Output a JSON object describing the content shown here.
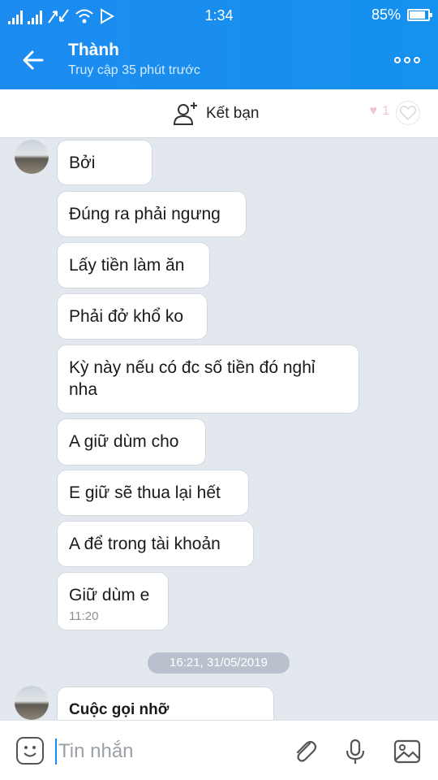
{
  "status_bar": {
    "time": "1:34",
    "battery": "85%",
    "battery_level": 0.85
  },
  "header": {
    "contact_name": "Thành",
    "last_seen": "Truy cập 35 phút trước"
  },
  "friend_bar": {
    "add_friend_label": "Kết bạn",
    "like_count": "1"
  },
  "messages": [
    {
      "text": "Bởi"
    },
    {
      "text": "Đúng ra phải ngưng"
    },
    {
      "text": "Lấy tiền làm ăn"
    },
    {
      "text": "Phải đở khổ ko"
    },
    {
      "text": "Kỳ này nếu có đc số tiền đó nghỉ nha"
    },
    {
      "text": "A giữ dùm cho"
    },
    {
      "text": "E giữ sẽ thua lại hết"
    },
    {
      "text": "A để trong tài khoản"
    },
    {
      "text": "Giữ dùm e",
      "time": "11:20"
    }
  ],
  "date_separator": "16:21, 31/05/2019",
  "latest_message": {
    "text": "Cuộc gọi nhỡ"
  },
  "composer": {
    "placeholder": "Tin nhắn"
  }
}
